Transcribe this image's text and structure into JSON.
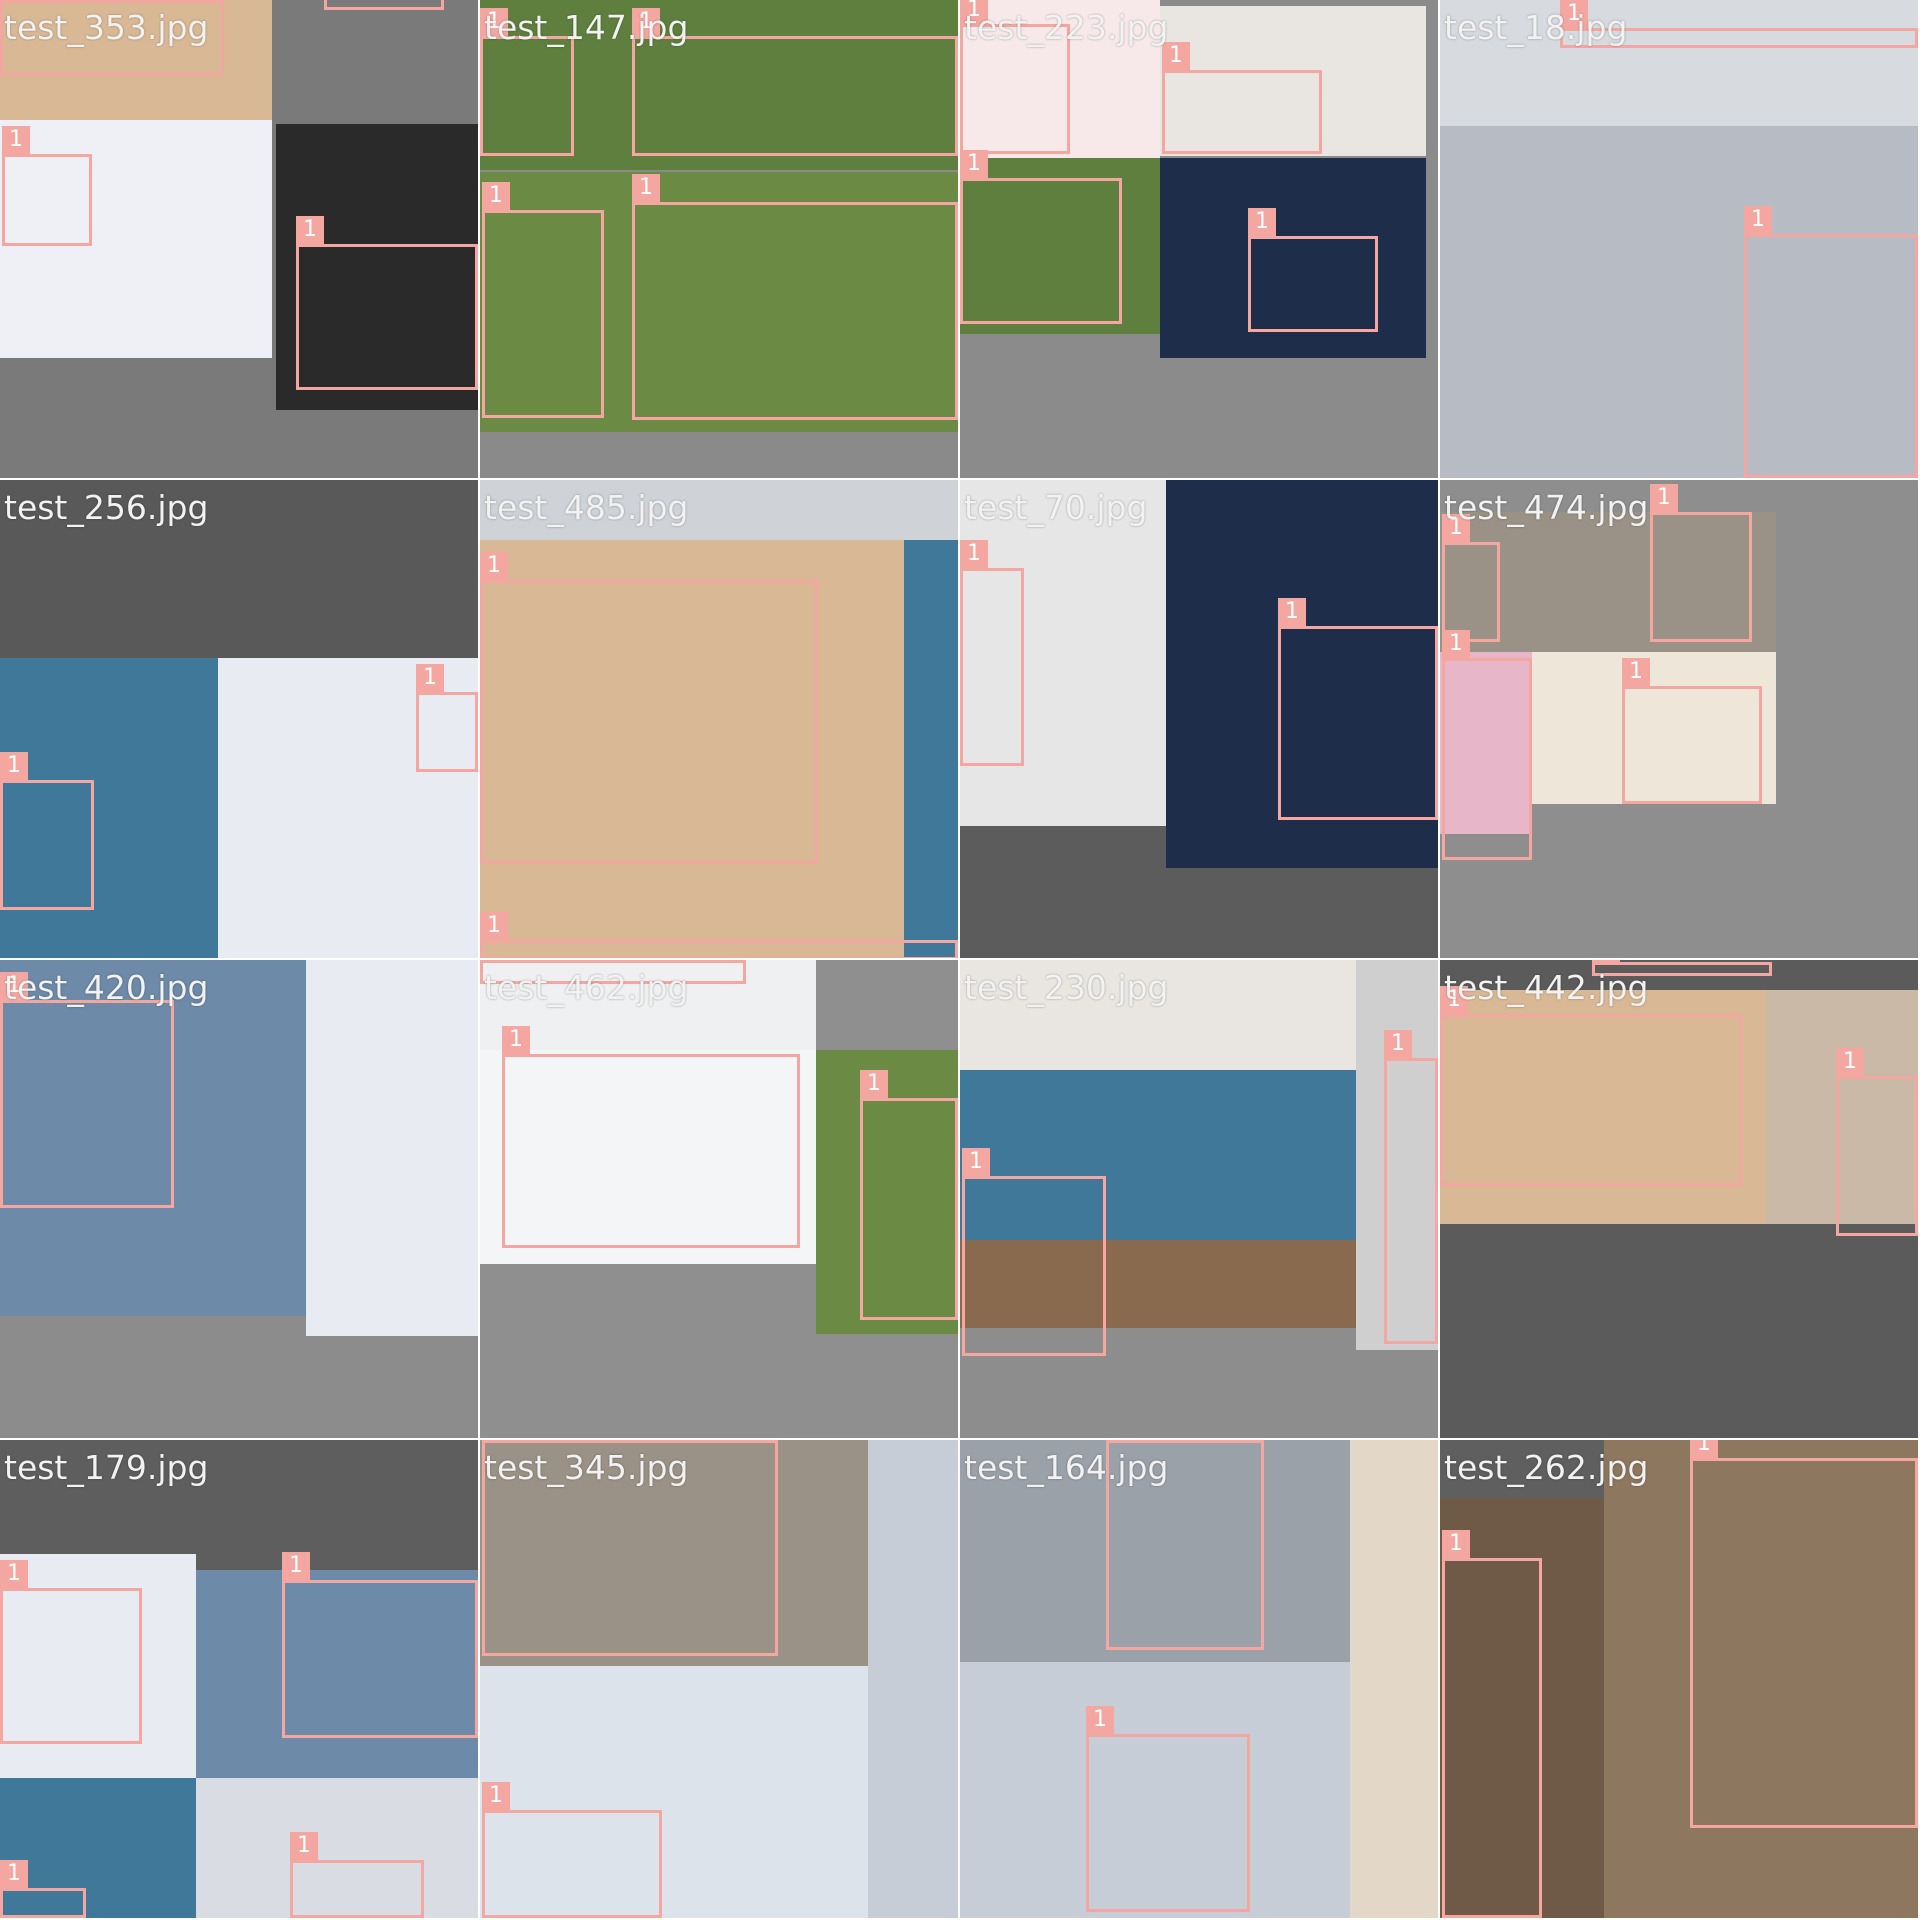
{
  "window": {
    "title": ""
  },
  "detection": {
    "class_label": "1",
    "box_color": "#f4a7a1"
  },
  "tiles": [
    {
      "caption": "test_353.jpg",
      "background": "#7a7a7a"
    },
    {
      "caption": "test_147.jpg",
      "background": "#8a8a8a"
    },
    {
      "caption": "test_223.jpg",
      "background": "#8b8b8b"
    },
    {
      "caption": "test_18.jpg",
      "background": "#7b8592"
    },
    {
      "caption": "test_256.jpg",
      "background": "#595959"
    },
    {
      "caption": "test_485.jpg",
      "background": "#cfd3d8"
    },
    {
      "caption": "test_70.jpg",
      "background": "#5c5c5c"
    },
    {
      "caption": "test_474.jpg",
      "background": "#8e8e8e"
    },
    {
      "caption": "test_420.jpg",
      "background": "#8c8c8c"
    },
    {
      "caption": "test_462.jpg",
      "background": "#8f8f8f"
    },
    {
      "caption": "test_230.jpg",
      "background": "#8d8d8d"
    },
    {
      "caption": "test_442.jpg",
      "background": "#5b5b5b"
    },
    {
      "caption": "test_179.jpg",
      "background": "#5e5e5e"
    },
    {
      "caption": "test_345.jpg",
      "background": "#a59e8c"
    },
    {
      "caption": "test_164.jpg",
      "background": "#9aa1a8"
    },
    {
      "caption": "test_262.jpg",
      "background": "#5f5f5f"
    }
  ],
  "photo_colors": {
    "snow": "#e8ecf2",
    "grass": "#5f7f3e",
    "floor": "#d9b995",
    "sofa": "#3f7898",
    "dark": "#3a3a3a",
    "ice": "#c7cdd6",
    "crowd": "#6d8aa8",
    "road": "#9a9286",
    "night": "#1e2d4a",
    "skin": "#e3b89a"
  }
}
